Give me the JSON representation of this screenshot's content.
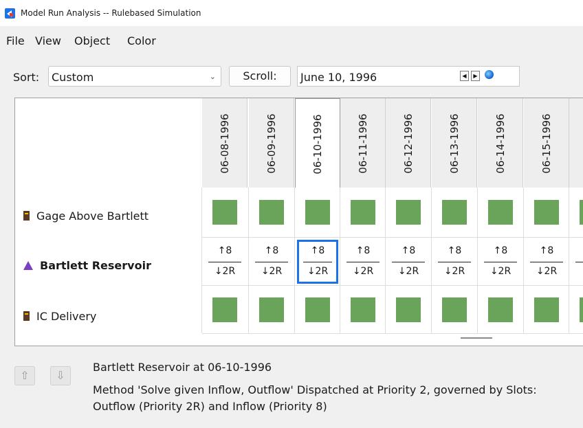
{
  "window": {
    "title": "Model Run Analysis -- Rulebased Simulation"
  },
  "menu": [
    "File",
    "View",
    "Object",
    "Color"
  ],
  "toolbar": {
    "sort_label": "Sort:",
    "sort_value": "Custom",
    "scroll_label": "Scroll:",
    "date_value": "June 10, 1996",
    "prev_icon": "triangle-left-icon",
    "next_icon": "triangle-right-icon",
    "globe_icon": "globe-icon"
  },
  "grid": {
    "columns": [
      "06-08-1996",
      "06-09-1996",
      "06-10-1996",
      "06-11-1996",
      "06-12-1996",
      "06-13-1996",
      "06-14-1996",
      "06-15-1996"
    ],
    "selected_column": "06-10-1996",
    "rows": [
      {
        "label": "Gage Above Bartlett",
        "icon": "gage-icon",
        "bold": false,
        "cell_type": "solved"
      },
      {
        "label": "Bartlett Reservoir",
        "icon": "reservoir-icon",
        "bold": true,
        "cell_type": "dispatch",
        "cell_top": "↑8",
        "cell_bottom": "↓2R"
      },
      {
        "label": "IC Delivery",
        "icon": "gage-icon",
        "bold": false,
        "cell_type": "solved"
      }
    ],
    "solved_color": "#6aa35a",
    "selection_color": "#1a73e8"
  },
  "info": {
    "title": "Bartlett Reservoir at 06-10-1996",
    "detail_line1": "Method 'Solve given Inflow, Outflow' Dispatched at Priority 2, governed by Slots:",
    "detail_line2": "Outflow (Priority 2R) and Inflow (Priority 8)"
  },
  "buttons": {
    "up_icon": "arrow-up-icon",
    "down_icon": "arrow-down-icon"
  }
}
